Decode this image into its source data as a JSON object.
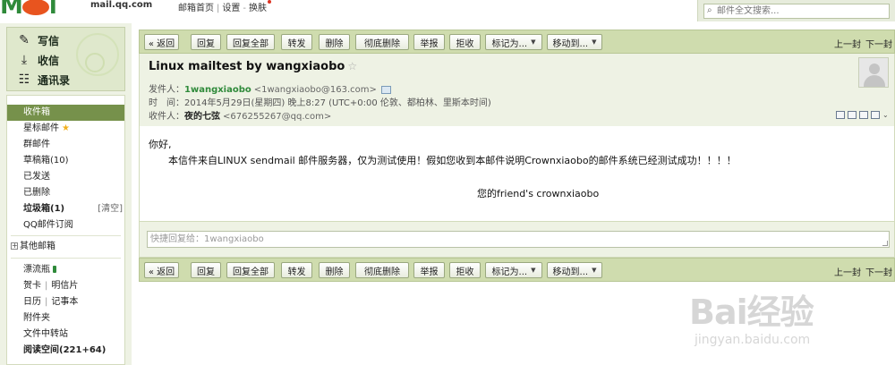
{
  "topbar": {
    "logo_url": "mail.qq.com",
    "links": [
      "邮箱首页",
      "设置",
      "换肤"
    ],
    "search_placeholder": "邮件全文搜索..."
  },
  "sidebar": {
    "actions": [
      {
        "label": "写信",
        "icon": "pencil-icon"
      },
      {
        "label": "收信",
        "icon": "inbox-download-icon"
      },
      {
        "label": "通讯录",
        "icon": "address-book-icon"
      }
    ],
    "folders": {
      "inbox": "收件箱",
      "starred": "星标邮件",
      "group": "群邮件",
      "drafts": "草稿箱(10)",
      "sent": "已发送",
      "deleted": "已删除",
      "spam": "垃圾箱(1)",
      "spam_clear": "[清空]",
      "subscriptions": "QQ邮件订阅",
      "other_mailbox": "其他邮箱",
      "drift_bottle": "漂流瓶",
      "card": "贺卡",
      "postcard": "明信片",
      "calendar": "日历",
      "notes": "记事本",
      "attachments": "附件夹",
      "file_transfer": "文件中转站",
      "reading": "阅读空间(221+64)"
    }
  },
  "toolbar": {
    "buttons": {
      "back": "« 返回",
      "reply": "回复",
      "reply_all": "回复全部",
      "forward": "转发",
      "delete": "删除",
      "delete_permanent": "彻底删除",
      "report": "举报",
      "reject": "拒收",
      "mark_as": "标记为...",
      "move_to": "移动到..."
    },
    "prev": "上一封",
    "next": "下一封"
  },
  "mail": {
    "subject": "Linux mailtest by wangxiaobo",
    "from_label": "发件人：",
    "from_name": "1wangxiaobo",
    "from_addr": "<1wangxiaobo@163.com>",
    "time_label": "时　间：",
    "time_value": "2014年5月29日(星期四) 晚上8:27 (UTC+0:00 伦敦、都柏林、里斯本时间)",
    "to_label": "收件人：",
    "to_name": "夜的七弦",
    "to_addr": "<676255267@qq.com>",
    "body": {
      "greeting": "你好,",
      "content": "本信件来自LINUX sendmail 邮件服务器，仅为测试使用！假如您收到本邮件说明Crownxiaobo的邮件系统已经测试成功！！！！",
      "signature": "您的friend's crownxiaobo"
    },
    "quick_reply_placeholder": "快捷回复给：1wangxiaobo"
  },
  "watermark": {
    "brand": "Bai经验",
    "url": "jingyan.baidu.com"
  }
}
